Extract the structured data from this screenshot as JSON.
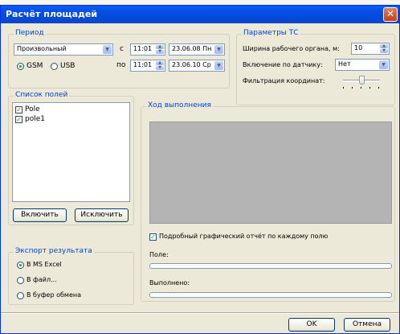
{
  "window": {
    "title": "Расчёт площадей"
  },
  "period": {
    "legend": "Период",
    "mode_value": "Произвольный",
    "from_label": "с",
    "from_time": "11:01",
    "from_date": "23.06.08 Пн",
    "to_label": "по",
    "to_time": "11:01",
    "to_date": "23.06.10 Ср",
    "gsm_label": "GSM",
    "usb_label": "USB",
    "selected_source": "GSM"
  },
  "params": {
    "legend": "Параметры ТС",
    "width_label": "Ширина рабочего органа, м:",
    "width_value": "10",
    "sensor_label": "Включение по датчику:",
    "sensor_value": "Нет",
    "filter_label": "Фильтрация координат:"
  },
  "fields": {
    "legend": "Список полей",
    "items": [
      {
        "label": "Pole",
        "checked": true
      },
      {
        "label": "pole1",
        "checked": true
      }
    ],
    "include_label": "Включить",
    "exclude_label": "Исключить"
  },
  "progress": {
    "legend": "Ход выполнения",
    "detailed_report_label": "Подробный графический отчёт по каждому полю",
    "detailed_report_checked": true,
    "field_label": "Поле:",
    "field_progress": 0,
    "done_label": "Выполнено:",
    "done_progress": 0
  },
  "export": {
    "legend": "Экспорт результата",
    "options": [
      "В MS Excel",
      "В файл...",
      "В буфер обмена"
    ],
    "selected": "В MS Excel"
  },
  "footer": {
    "ok_label": "OK",
    "cancel_label": "Отмена"
  }
}
